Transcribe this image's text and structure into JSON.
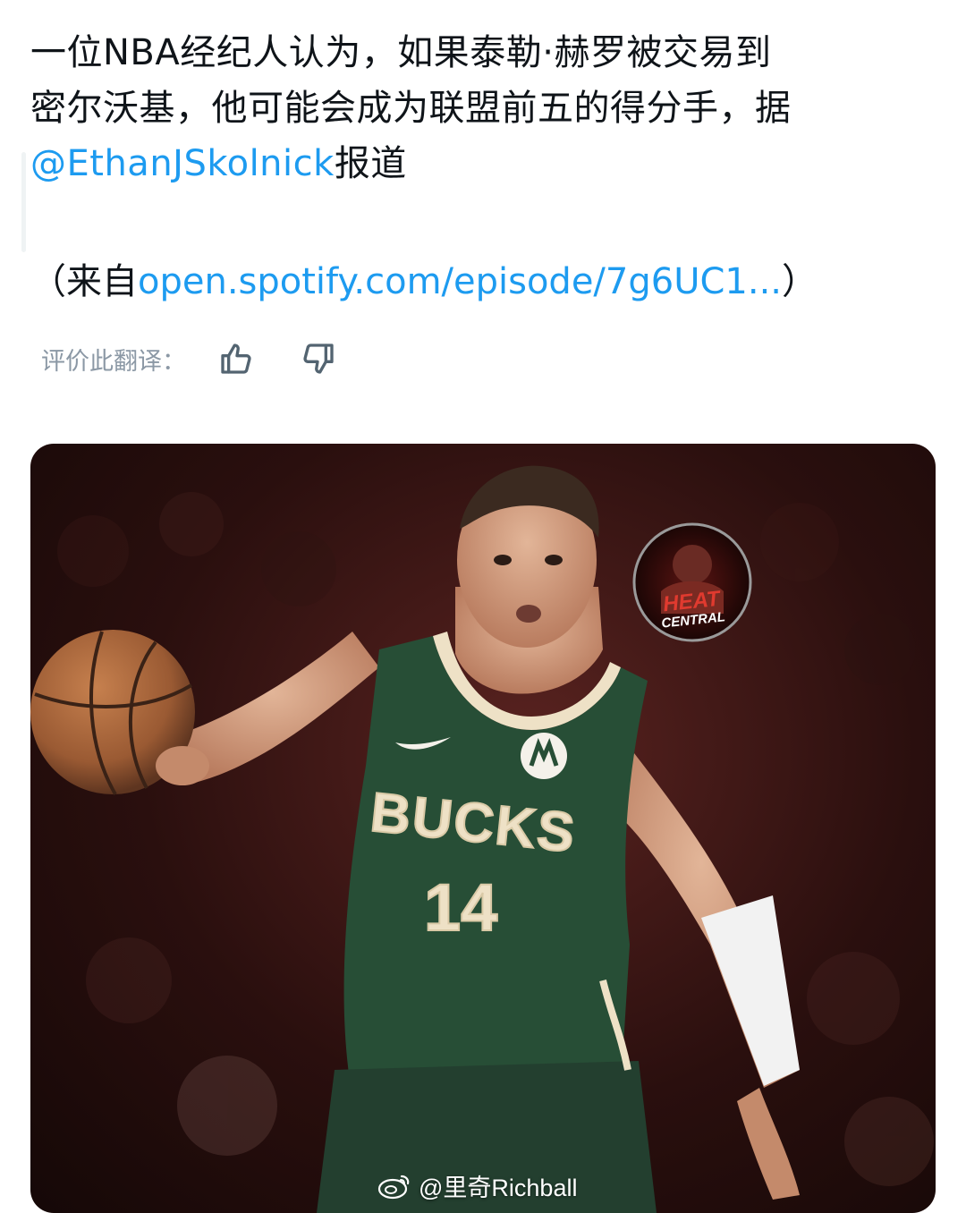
{
  "post": {
    "line1": "一位NBA经纪人认为，如果泰勒·赫罗被交易到",
    "line2": "密尔沃基，他可能会成为联盟前五的得分手，据",
    "mention": "@EthanJSkolnick",
    "line3_suffix": "报道",
    "source_prefix": "（来自",
    "source_link": "open.spotify.com/episode/7g6UC1...",
    "source_suffix": "）"
  },
  "rating": {
    "label": "评价此翻译：",
    "thumbs_up_icon": "thumbs-up-icon",
    "thumbs_down_icon": "thumbs-down-icon"
  },
  "media": {
    "jersey_team": "BUCKS",
    "jersey_number": "14",
    "badge_line1": "HEAT",
    "badge_line2": "CENTRAL",
    "watermark": "@里奇Richball"
  },
  "colors": {
    "link": "#1d9bf0",
    "jersey_green": "#274e36",
    "jersey_cream": "#eee1c6",
    "muted_text": "#8b98a5"
  }
}
